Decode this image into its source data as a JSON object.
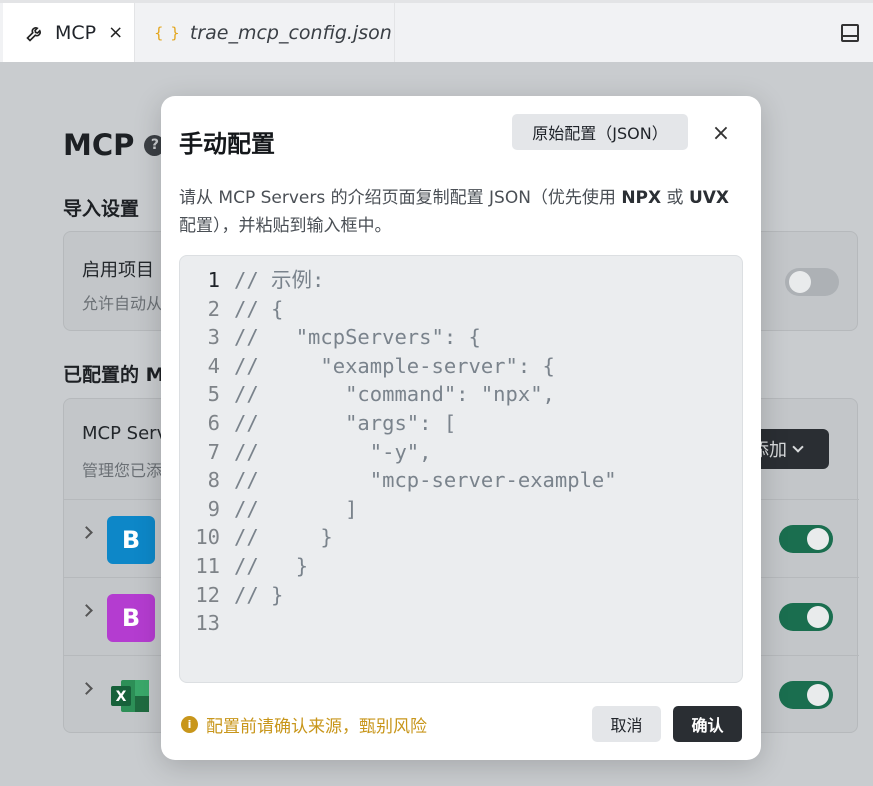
{
  "tabs": [
    {
      "label": "MCP",
      "icon": "wrench-icon",
      "close": "×"
    },
    {
      "label": "trae_mcp_config.json",
      "icon": "braces-icon",
      "icon_glyph": "{ }"
    }
  ],
  "page": {
    "title": "MCP",
    "help_glyph": "?",
    "import_section": "导入设置",
    "import_card_title": "启用项目",
    "import_card_sub": "允许自动从",
    "configured_section": "已配置的 M",
    "servers_card_title": "MCP Serv",
    "servers_card_sub": "管理您已添",
    "add_button": "添加",
    "servers": [
      {
        "logo": "B",
        "color": "#0d87c8",
        "enabled": true
      },
      {
        "logo": "B",
        "color": "#b43cd0",
        "enabled": true
      },
      {
        "logo": "X",
        "color": "#1e7a45",
        "enabled": true
      }
    ]
  },
  "modal": {
    "title": "手动配置",
    "raw_config_button": "原始配置（JSON）",
    "close": "×",
    "desc_1": "请从 MCP Servers 的介绍页面复制配置 JSON（优先使用 ",
    "desc_npx": "NPX",
    "desc_2": " 或 ",
    "desc_uvx": "UVX",
    "desc_3": " 配置），并粘贴到输入框中。",
    "code_lines": [
      "// 示例:",
      "// {",
      "//   \"mcpServers\": {",
      "//     \"example-server\": {",
      "//       \"command\": \"npx\",",
      "//       \"args\": [",
      "//         \"-y\",",
      "//         \"mcp-server-example\"",
      "//       ]",
      "//     }",
      "//   }",
      "// }",
      ""
    ],
    "warning": "配置前请确认来源，甄别风险",
    "cancel": "取消",
    "confirm": "确认"
  }
}
